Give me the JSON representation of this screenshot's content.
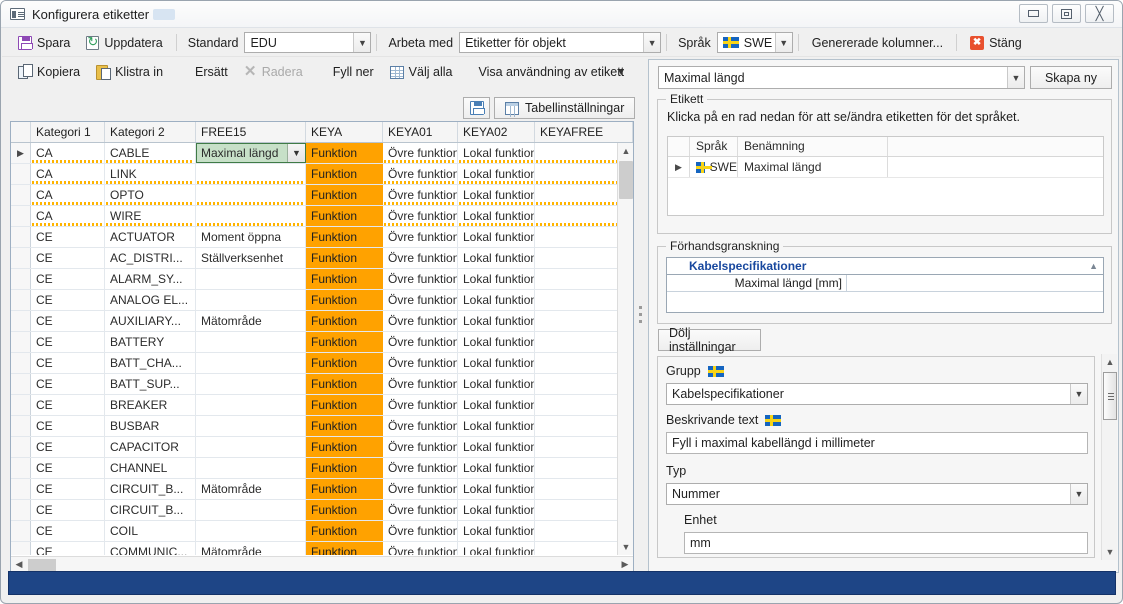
{
  "window": {
    "title": "Konfigurera etiketter",
    "icon": "label-card-icon",
    "buttons": {
      "minimize": "minimize-icon",
      "maximize": "maximize-icon",
      "close": "close-icon"
    }
  },
  "toolbar_top": {
    "save": "Spara",
    "update": "Uppdatera",
    "standard_label": "Standard",
    "standard_value": "EDU",
    "work_with_label": "Arbeta med",
    "work_with_value": "Etiketter för objekt",
    "language_label": "Språk",
    "language_value": "SWE",
    "generated_columns": "Genererade kolumner...",
    "close": "Stäng"
  },
  "toolbar_second": {
    "copy": "Kopiera",
    "paste": "Klistra in",
    "replace": "Ersätt",
    "delete": "Radera",
    "fill_down": "Fyll ner",
    "select_all": "Välj alla",
    "show_usage": "Visa användning av etikett"
  },
  "grid_toolbar": {
    "save_icon": "save-icon",
    "table_settings": "Tabellinställningar"
  },
  "grid": {
    "columns": [
      "Kategori 1",
      "Kategori 2",
      "FREE15",
      "KEYA",
      "KEYA01",
      "KEYA02",
      "KEYAFREE"
    ],
    "selected_cell_value": "Maximal längd",
    "rows": [
      {
        "c1": "CA",
        "c2": "CABLE",
        "free15": "Maximal längd",
        "keya": "Funktion",
        "keya01": "Övre funktion",
        "keya02": "Lokal funktion",
        "keyafree": "",
        "selected": true
      },
      {
        "c1": "CA",
        "c2": "LINK",
        "free15": "",
        "keya": "Funktion",
        "keya01": "Övre funktion",
        "keya02": "Lokal funktion",
        "keyafree": ""
      },
      {
        "c1": "CA",
        "c2": "OPTO",
        "free15": "",
        "keya": "Funktion",
        "keya01": "Övre funktion",
        "keya02": "Lokal funktion",
        "keyafree": ""
      },
      {
        "c1": "CA",
        "c2": "WIRE",
        "free15": "",
        "keya": "Funktion",
        "keya01": "Övre funktion",
        "keya02": "Lokal funktion",
        "keyafree": ""
      },
      {
        "c1": "CE",
        "c2": "ACTUATOR",
        "free15": "Moment öppna",
        "keya": "Funktion",
        "keya01": "Övre funktion",
        "keya02": "Lokal funktion",
        "keyafree": ""
      },
      {
        "c1": "CE",
        "c2": "AC_DISTRI...",
        "free15": "Ställverksenhet",
        "keya": "Funktion",
        "keya01": "Övre funktion",
        "keya02": "Lokal funktion",
        "keyafree": ""
      },
      {
        "c1": "CE",
        "c2": "ALARM_SY...",
        "free15": "",
        "keya": "Funktion",
        "keya01": "Övre funktion",
        "keya02": "Lokal funktion",
        "keyafree": ""
      },
      {
        "c1": "CE",
        "c2": "ANALOG EL...",
        "free15": "",
        "keya": "Funktion",
        "keya01": "Övre funktion",
        "keya02": "Lokal funktion",
        "keyafree": ""
      },
      {
        "c1": "CE",
        "c2": "AUXILIARY...",
        "free15": "Mätområde",
        "keya": "Funktion",
        "keya01": "Övre funktion",
        "keya02": "Lokal funktion",
        "keyafree": ""
      },
      {
        "c1": "CE",
        "c2": "BATTERY",
        "free15": "",
        "keya": "Funktion",
        "keya01": "Övre funktion",
        "keya02": "Lokal funktion",
        "keyafree": ""
      },
      {
        "c1": "CE",
        "c2": "BATT_CHA...",
        "free15": "",
        "keya": "Funktion",
        "keya01": "Övre funktion",
        "keya02": "Lokal funktion",
        "keyafree": ""
      },
      {
        "c1": "CE",
        "c2": "BATT_SUP...",
        "free15": "",
        "keya": "Funktion",
        "keya01": "Övre funktion",
        "keya02": "Lokal funktion",
        "keyafree": ""
      },
      {
        "c1": "CE",
        "c2": "BREAKER",
        "free15": "",
        "keya": "Funktion",
        "keya01": "Övre funktion",
        "keya02": "Lokal funktion",
        "keyafree": ""
      },
      {
        "c1": "CE",
        "c2": "BUSBAR",
        "free15": "",
        "keya": "Funktion",
        "keya01": "Övre funktion",
        "keya02": "Lokal funktion",
        "keyafree": ""
      },
      {
        "c1": "CE",
        "c2": "CAPACITOR",
        "free15": "",
        "keya": "Funktion",
        "keya01": "Övre funktion",
        "keya02": "Lokal funktion",
        "keyafree": ""
      },
      {
        "c1": "CE",
        "c2": "CHANNEL",
        "free15": "",
        "keya": "Funktion",
        "keya01": "Övre funktion",
        "keya02": "Lokal funktion",
        "keyafree": ""
      },
      {
        "c1": "CE",
        "c2": "CIRCUIT_B...",
        "free15": "Mätområde",
        "keya": "Funktion",
        "keya01": "Övre funktion",
        "keya02": "Lokal funktion",
        "keyafree": ""
      },
      {
        "c1": "CE",
        "c2": "CIRCUIT_B...",
        "free15": "",
        "keya": "Funktion",
        "keya01": "Övre funktion",
        "keya02": "Lokal funktion",
        "keyafree": ""
      },
      {
        "c1": "CE",
        "c2": "COIL",
        "free15": "",
        "keya": "Funktion",
        "keya01": "Övre funktion",
        "keya02": "Lokal funktion",
        "keyafree": ""
      },
      {
        "c1": "CE",
        "c2": "COMMUNIC...",
        "free15": "Mätområde",
        "keya": "Funktion",
        "keya01": "Övre funktion",
        "keya02": "Lokal funktion",
        "keyafree": ""
      }
    ]
  },
  "right_panel": {
    "name_combo_value": "Maximal längd",
    "create_new_button": "Skapa ny",
    "label_group_title": "Etikett",
    "label_hint": "Klicka på en rad nedan för att se/ändra etiketten för det språket.",
    "lang_table": {
      "columns": [
        "Språk",
        "Benämning"
      ],
      "rows": [
        {
          "lang": "SWE",
          "name": "Maximal längd"
        }
      ]
    },
    "preview_group_title": "Förhandsgranskning",
    "preview": {
      "header": "Kabelspecifikationer",
      "rows": [
        {
          "key": "Maximal längd [mm]",
          "value": ""
        }
      ]
    },
    "hide_settings_button": "Dölj inställningar",
    "group_label": "Grupp",
    "group_value": "Kabelspecifikationer",
    "desc_label": "Beskrivande text",
    "desc_value": "Fyll i maximal kabellängd i millimeter",
    "type_label": "Typ",
    "type_value": "Nummer",
    "unit_label": "Enhet",
    "unit_value": "mm"
  },
  "colors": {
    "accent_orange": "#ffa200",
    "selection_green": "#c7e0c8",
    "status_blue": "#1e4586",
    "link_blue": "#17479e"
  }
}
